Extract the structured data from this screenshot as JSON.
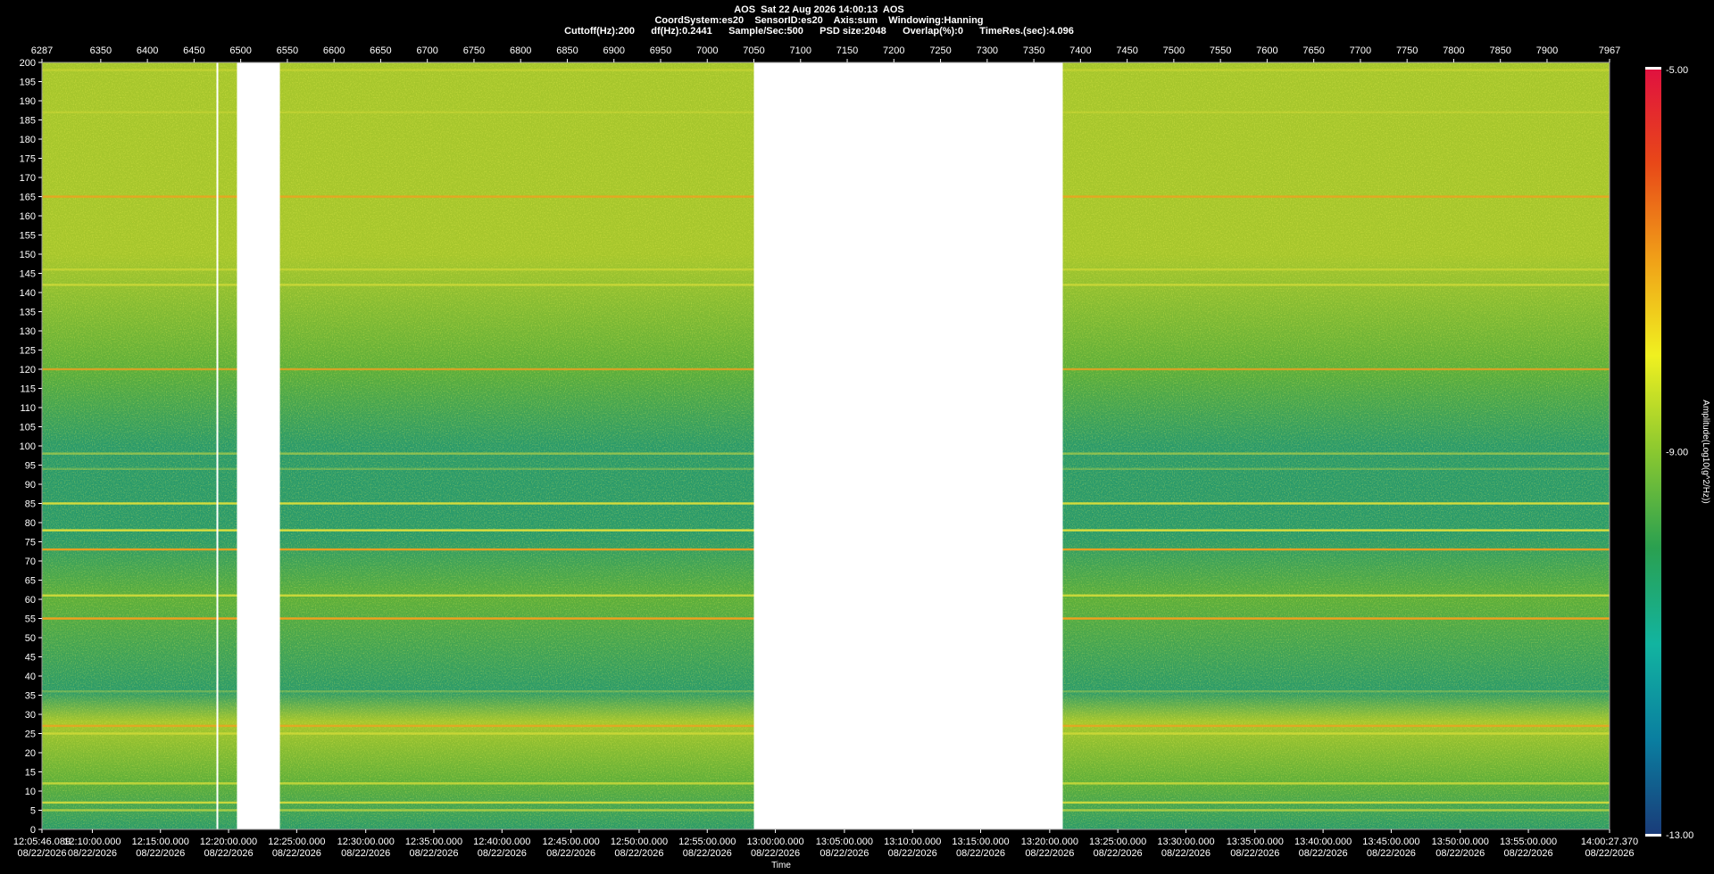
{
  "header": {
    "line1": "AOS  Sat 22 Aug 2026 14:00:13  AOS",
    "line2": "CoordSystem:es20    SensorID:es20    Axis:sum    Windowing:Hanning",
    "line3": "Cuttoff(Hz):200      df(Hz):0.2441      Sample/Sec:500      PSD size:2048      Overlap(%):0      TimeRes.(sec):4.096"
  },
  "colors": {
    "background": "#000000",
    "gap": "#ffffff",
    "base_low": "#2a9a6a",
    "base_mid": "#5cae3a",
    "base_high": "#a6c62c",
    "line_yellow": "#e6e23a",
    "line_orange": "#f0a020",
    "line_red": "#e04010"
  },
  "chart_data": {
    "type": "heatmap",
    "xlabel": "Time",
    "ylabel": "",
    "top_axis": {
      "range": [
        6287,
        7967
      ],
      "ticks": [
        6287,
        6350,
        6400,
        6450,
        6500,
        6550,
        6600,
        6650,
        6700,
        6750,
        6800,
        6850,
        6900,
        6950,
        7000,
        7050,
        7100,
        7150,
        7200,
        7250,
        7300,
        7350,
        7400,
        7450,
        7500,
        7550,
        7600,
        7650,
        7700,
        7750,
        7800,
        7850,
        7900,
        7967
      ]
    },
    "y_axis": {
      "range": [
        0,
        200
      ],
      "ticks": [
        0,
        5,
        10,
        15,
        20,
        25,
        30,
        35,
        40,
        45,
        50,
        55,
        60,
        65,
        70,
        75,
        80,
        85,
        90,
        95,
        100,
        105,
        110,
        115,
        120,
        125,
        130,
        135,
        140,
        145,
        150,
        155,
        160,
        165,
        170,
        175,
        180,
        185,
        190,
        195,
        200
      ]
    },
    "x_time_ticks": [
      {
        "pos": 6287,
        "time": "12:05:46.089",
        "date": "08/22/2026"
      },
      {
        "pos": 6341,
        "time": "12:10:00.000",
        "date": "08/22/2026"
      },
      {
        "pos": 6414,
        "time": "12:15:00.000",
        "date": "08/22/2026"
      },
      {
        "pos": 6487,
        "time": "12:20:00.000",
        "date": "08/22/2026"
      },
      {
        "pos": 6560,
        "time": "12:25:00.000",
        "date": "08/22/2026"
      },
      {
        "pos": 6634,
        "time": "12:30:00.000",
        "date": "08/22/2026"
      },
      {
        "pos": 6707,
        "time": "12:35:00.000",
        "date": "08/22/2026"
      },
      {
        "pos": 6780,
        "time": "12:40:00.000",
        "date": "08/22/2026"
      },
      {
        "pos": 6854,
        "time": "12:45:00.000",
        "date": "08/22/2026"
      },
      {
        "pos": 6927,
        "time": "12:50:00.000",
        "date": "08/22/2026"
      },
      {
        "pos": 7000,
        "time": "12:55:00.000",
        "date": "08/22/2026"
      },
      {
        "pos": 7073,
        "time": "13:00:00.000",
        "date": "08/22/2026"
      },
      {
        "pos": 7147,
        "time": "13:05:00.000",
        "date": "08/22/2026"
      },
      {
        "pos": 7220,
        "time": "13:10:00.000",
        "date": "08/22/2026"
      },
      {
        "pos": 7293,
        "time": "13:15:00.000",
        "date": "08/22/2026"
      },
      {
        "pos": 7367,
        "time": "13:20:00.000",
        "date": "08/22/2026"
      },
      {
        "pos": 7440,
        "time": "13:25:00.000",
        "date": "08/22/2026"
      },
      {
        "pos": 7513,
        "time": "13:30:00.000",
        "date": "08/22/2026"
      },
      {
        "pos": 7587,
        "time": "13:35:00.000",
        "date": "08/22/2026"
      },
      {
        "pos": 7660,
        "time": "13:40:00.000",
        "date": "08/22/2026"
      },
      {
        "pos": 7733,
        "time": "13:45:00.000",
        "date": "08/22/2026"
      },
      {
        "pos": 7807,
        "time": "13:50:00.000",
        "date": "08/22/2026"
      },
      {
        "pos": 7880,
        "time": "13:55:00.000",
        "date": "08/22/2026"
      },
      {
        "pos": 7967,
        "time": "14:00:27.370",
        "date": "08/22/2026"
      }
    ],
    "data_gaps": [
      [
        6496,
        6542
      ],
      [
        7050,
        7381
      ]
    ],
    "white_line_at": 6475,
    "harmonic_lines": [
      {
        "hz": 198,
        "strength": 0.35,
        "color": "yellow"
      },
      {
        "hz": 187,
        "strength": 0.3,
        "color": "yellow"
      },
      {
        "hz": 165,
        "strength": 0.85,
        "color": "orange"
      },
      {
        "hz": 146,
        "strength": 0.45,
        "color": "yellow"
      },
      {
        "hz": 142,
        "strength": 0.6,
        "color": "yellow"
      },
      {
        "hz": 120,
        "strength": 0.8,
        "color": "orange"
      },
      {
        "hz": 98,
        "strength": 0.5,
        "color": "yellow"
      },
      {
        "hz": 94,
        "strength": 0.3,
        "color": "yellow"
      },
      {
        "hz": 85,
        "strength": 0.9,
        "color": "yellow"
      },
      {
        "hz": 78,
        "strength": 0.95,
        "color": "yellow"
      },
      {
        "hz": 73,
        "strength": 0.95,
        "color": "orange"
      },
      {
        "hz": 61,
        "strength": 0.8,
        "color": "yellow"
      },
      {
        "hz": 55,
        "strength": 1.0,
        "color": "orange"
      },
      {
        "hz": 36,
        "strength": 0.3,
        "color": "yellow"
      },
      {
        "hz": 27,
        "strength": 0.8,
        "color": "orange"
      },
      {
        "hz": 25,
        "strength": 0.6,
        "color": "yellow"
      },
      {
        "hz": 12,
        "strength": 0.7,
        "color": "yellow"
      },
      {
        "hz": 7,
        "strength": 0.8,
        "color": "yellow"
      },
      {
        "hz": 5,
        "strength": 0.6,
        "color": "yellow"
      }
    ],
    "colorbar": {
      "label": "Amplitude(Log10(g^2/Hz))",
      "ticks": [
        "-5.00",
        "-9.00",
        "-13.00"
      ],
      "range": [
        -13,
        -5
      ],
      "stops": [
        "#1a3a78",
        "#0a7ea0",
        "#12b4a0",
        "#2aa050",
        "#8ac830",
        "#f0f020",
        "#f0a018",
        "#e84818",
        "#e01040"
      ]
    }
  }
}
